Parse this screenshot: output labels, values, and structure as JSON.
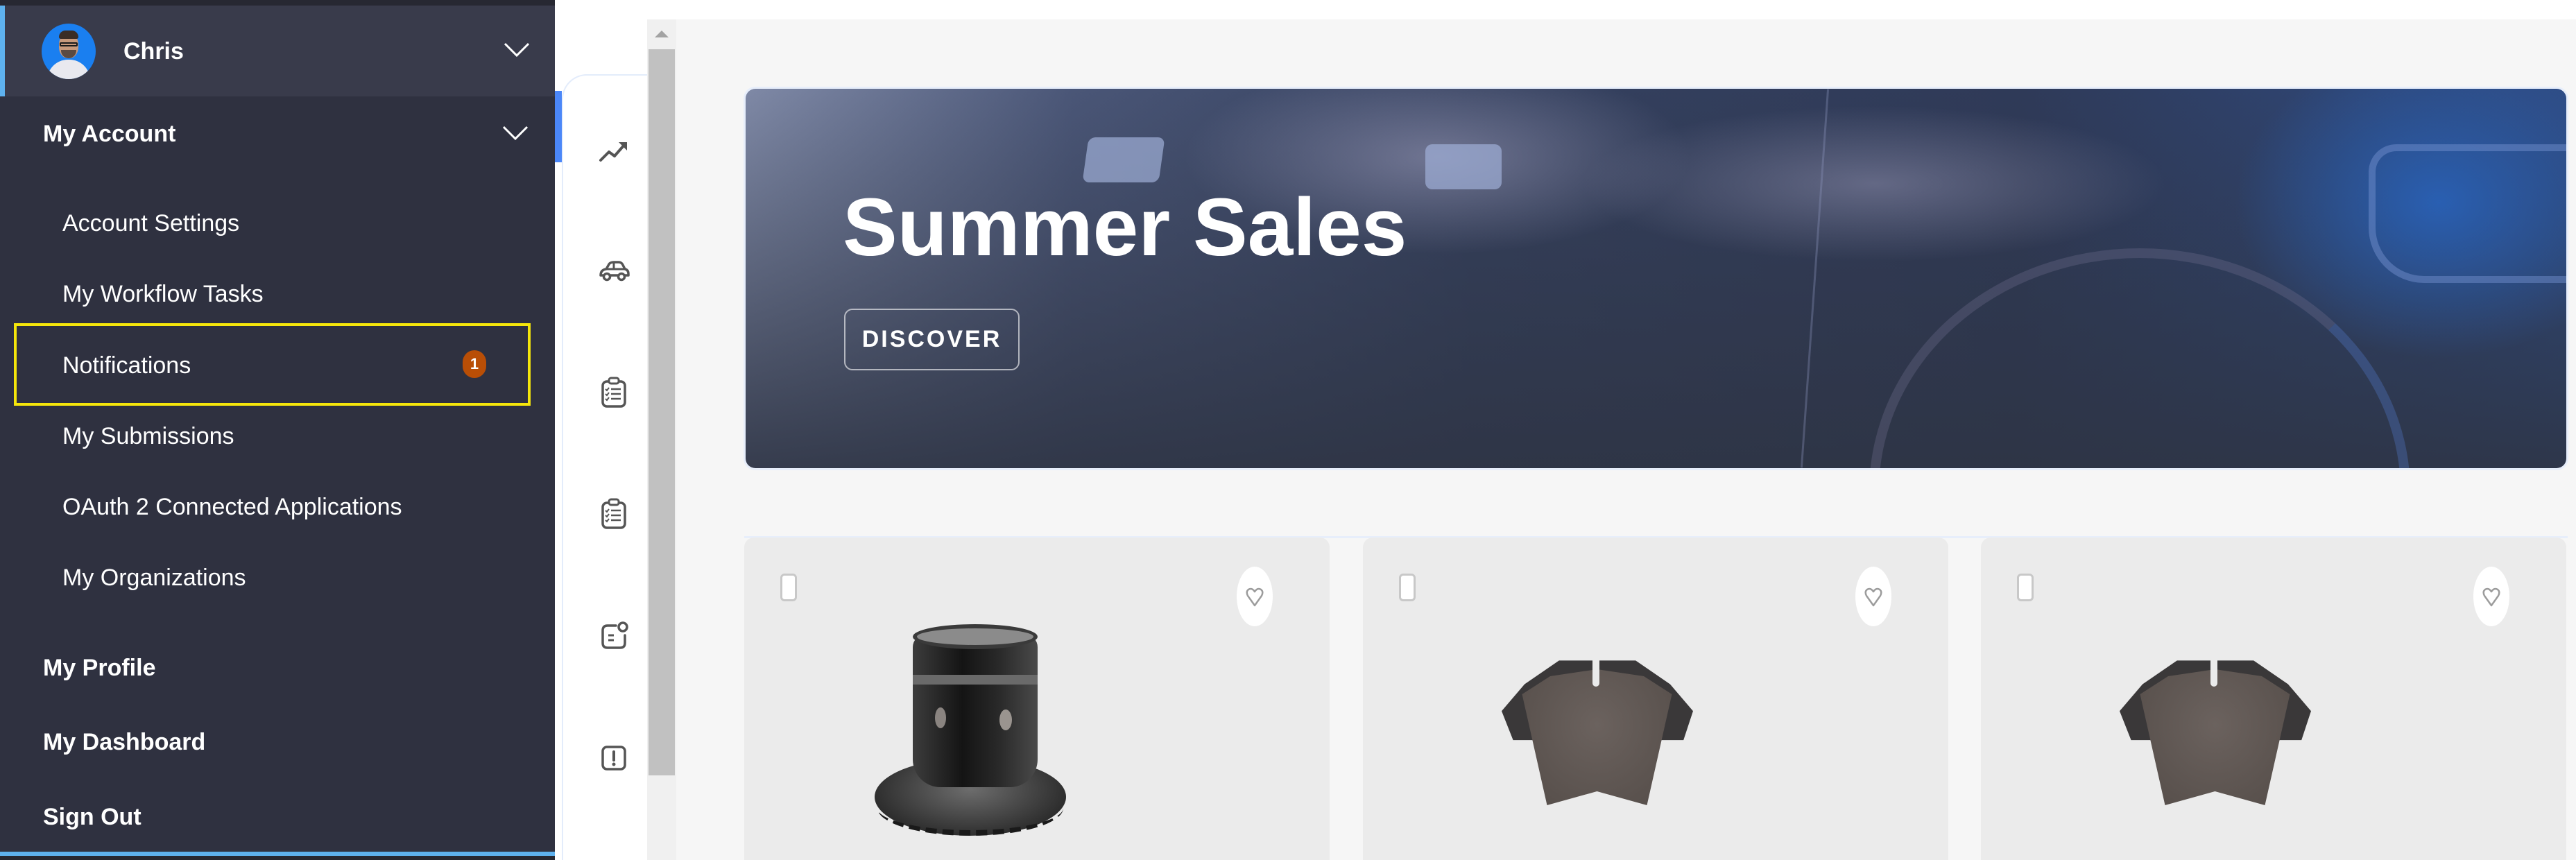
{
  "user": {
    "name": "Chris",
    "avatar_icon": "user-avatar"
  },
  "sidebar": {
    "sections": [
      {
        "label": "My Account",
        "expanded": true,
        "items": [
          {
            "label": "Account Settings"
          },
          {
            "label": "My Workflow Tasks"
          },
          {
            "label": "Notifications",
            "badge": "1",
            "highlighted": true
          },
          {
            "label": "My Submissions"
          },
          {
            "label": "OAuth 2 Connected Applications"
          },
          {
            "label": "My Organizations"
          }
        ]
      },
      {
        "label": "My Profile"
      },
      {
        "label": "My Dashboard"
      },
      {
        "label": "Sign Out"
      }
    ]
  },
  "rail": {
    "icons": [
      {
        "name": "trending-up-icon",
        "active": true
      },
      {
        "name": "car-icon"
      },
      {
        "name": "clipboard-list-icon"
      },
      {
        "name": "clipboard-list-icon"
      },
      {
        "name": "message-notification-icon"
      },
      {
        "name": "alert-square-icon"
      }
    ]
  },
  "banner": {
    "title": "Summer Sales",
    "cta_label": "DISCOVER"
  },
  "products": [
    {
      "image": "brake-disc-rotor",
      "selected": false,
      "favorite": false
    },
    {
      "image": "brake-pad",
      "selected": false,
      "favorite": false
    },
    {
      "image": "brake-pad",
      "selected": false,
      "favorite": false
    }
  ],
  "colors": {
    "sidebar_bg": "#2f3140",
    "user_row_bg": "#393b4b",
    "accent_blue": "#5eb1ee",
    "rail_active": "#4b87f8",
    "highlight_outline": "#f5e60b",
    "badge_bg": "#b94e06",
    "main_bg": "#f6f6f6",
    "card_bg": "#ebebeb"
  }
}
